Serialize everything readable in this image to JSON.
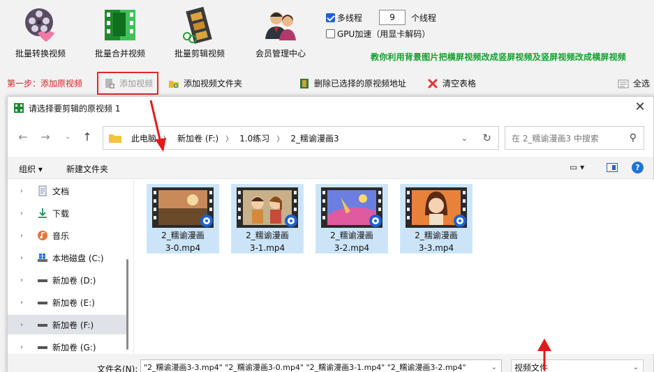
{
  "toolbar": {
    "batch_convert": "批量转换视频",
    "batch_merge": "批量合并视频",
    "batch_edit": "批量剪辑视频",
    "member_center": "会员管理中心"
  },
  "options": {
    "multithread_label": "多线程",
    "multithread_checked": true,
    "thread_count": "9",
    "thread_suffix": "个线程",
    "gpu_label": "GPU加速（用显卡解码）",
    "gpu_checked": false
  },
  "promo_text": "教你利用背景图片把横屏视频改成竖屏视频及竖屏视频改成横屏视频",
  "actions": {
    "step_label": "第一步：添加原视频",
    "add_video": "添加视频",
    "add_folder": "添加视频文件夹",
    "delete_selected": "删除已选择的原视频地址",
    "clear_table": "清空表格",
    "select_all": "全选"
  },
  "dialog": {
    "title": "请选择要剪辑的原视频 1",
    "breadcrumb": [
      "此电脑",
      "新加卷 (F:)",
      "1.0练习",
      "2_糯谕漫画3"
    ],
    "search_placeholder": "在 2_糯谕漫画3 中搜索",
    "organize": "组织 ▾",
    "new_folder": "新建文件夹",
    "sidebar": [
      {
        "label": "文档",
        "icon": "document-icon"
      },
      {
        "label": "下载",
        "icon": "download-icon"
      },
      {
        "label": "音乐",
        "icon": "music-icon"
      },
      {
        "label": "本地磁盘 (C:)",
        "icon": "windows-drive-icon"
      },
      {
        "label": "新加卷 (D:)",
        "icon": "drive-icon"
      },
      {
        "label": "新加卷 (E:)",
        "icon": "drive-icon"
      },
      {
        "label": "新加卷 (F:)",
        "icon": "drive-icon",
        "selected": true
      },
      {
        "label": "新加卷 (G:)",
        "icon": "drive-icon"
      }
    ],
    "files": [
      {
        "line1": "2_糯谕漫画",
        "line2": "3-0.mp4"
      },
      {
        "line1": "2_糯谕漫画",
        "line2": "3-1.mp4"
      },
      {
        "line1": "2_糯谕漫画",
        "line2": "3-2.mp4"
      },
      {
        "line1": "2_糯谕漫画",
        "line2": "3-3.mp4"
      }
    ],
    "filename_label": "文件名(N):",
    "filename_value": "\"2_糯谕漫画3-3.mp4\" \"2_糯谕漫画3-0.mp4\" \"2_糯谕漫画3-1.mp4\" \"2_糯谕漫画3-2.mp4\"",
    "filetype": "视频文件"
  },
  "colors": {
    "accent": "#1e62d0",
    "promo": "#11a02c",
    "step": "#d42020",
    "highlight": "#e0262b",
    "file_selected": "#cce4f7"
  }
}
